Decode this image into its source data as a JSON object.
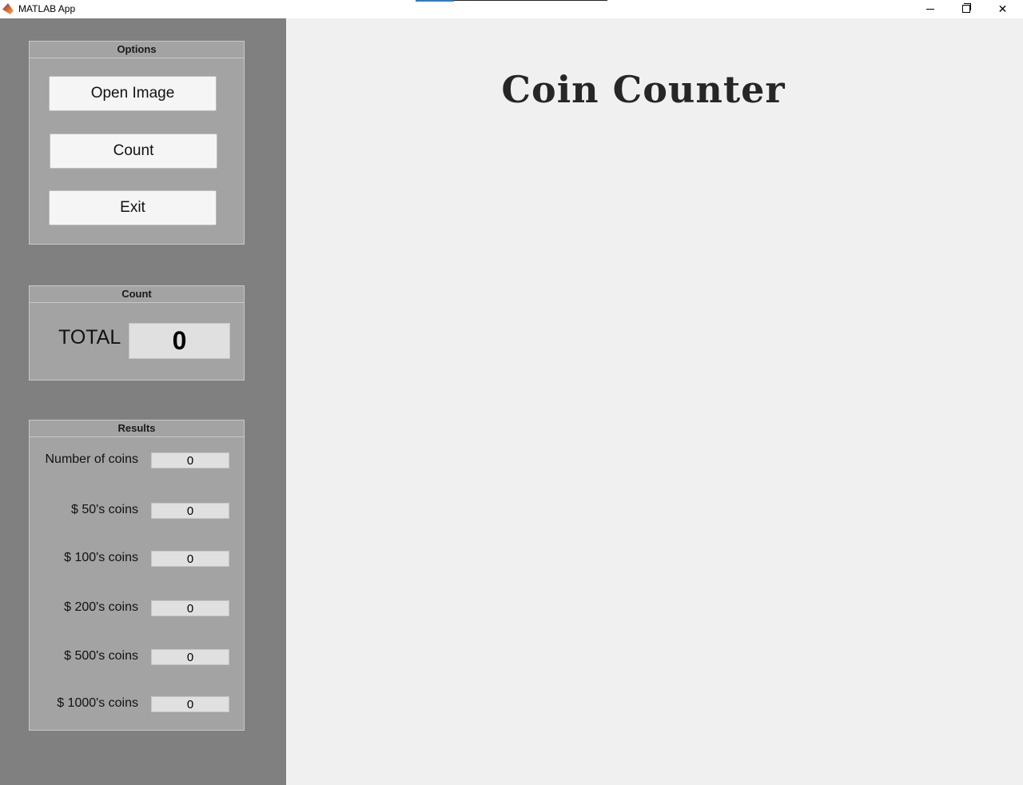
{
  "window": {
    "title": "MATLAB App",
    "app_icon": "matlab-membrane-icon",
    "controls": {
      "minimize_icon": "minimize-icon",
      "restore_icon": "restore-icon",
      "close_icon": "close-icon",
      "close_glyph": "✕"
    }
  },
  "main": {
    "heading": "Coin Counter"
  },
  "options": {
    "title": "Options",
    "open_image_label": "Open Image",
    "count_label": "Count",
    "exit_label": "Exit"
  },
  "count": {
    "title": "Count",
    "total_label": "TOTAL",
    "total_value": "0"
  },
  "results": {
    "title": "Results",
    "rows": [
      {
        "label": "Number of coins",
        "value": "0"
      },
      {
        "label": "$ 50's coins",
        "value": "0"
      },
      {
        "label": "$ 100's coins",
        "value": "0"
      },
      {
        "label": "$ 200's coins",
        "value": "0"
      },
      {
        "label": "$ 500's coins",
        "value": "0"
      },
      {
        "label": "$ 1000's coins",
        "value": "0"
      }
    ]
  },
  "colors": {
    "sidebar_bg": "#808080",
    "panel_bg": "#a3a3a3",
    "main_bg": "#f0f0f0",
    "heading_text": "#262626"
  }
}
